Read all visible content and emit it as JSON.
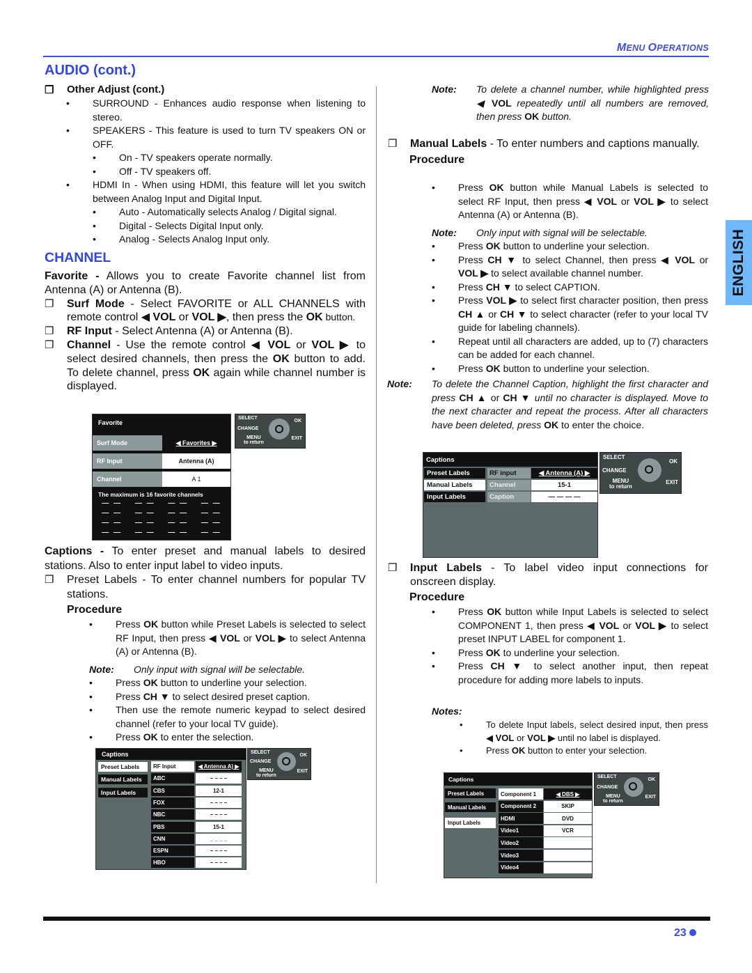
{
  "header": {
    "section_title_first": "M",
    "section_title_rest1": "ENU ",
    "section_title_second": "O",
    "section_title_rest2": "PERATIONS"
  },
  "language_tab": "ENGLISH",
  "page_number": "23",
  "left": {
    "audio_heading": "AUDIO (cont.)",
    "other_adjust": "Other Adjust (cont.)",
    "items": [
      "SURROUND - Enhances audio response when listening to stereo.",
      "SPEAKERS - This feature is used to turn TV speakers ON or OFF.",
      "HDMI In - When using HDMI, this feature will let you switch between Analog Input and Digital Input."
    ],
    "speakers_sub": [
      "On - TV speakers operate normally.",
      "Off - TV speakers off."
    ],
    "hdmi_sub": [
      "Auto - Automatically selects Analog / Digital signal.",
      "Digital - Selects Digital Input only.",
      "Analog - Selects Analog Input only."
    ],
    "channel_heading": "CHANNEL",
    "favorite_bold": "Favorite -",
    "favorite_text": " Allows you to create Favorite channel list from Antenna (A) or Antenna (B).",
    "surf_bold": "Surf Mode",
    "surf_text1": " - Select FAVORITE or ALL CHANNELS with remote control ◀ ",
    "surf_vol1": "VOL",
    "surf_or": " or ",
    "surf_vol2": "VOL ▶",
    "surf_text2": ", then press the ",
    "surf_ok": "OK",
    "surf_text3": " button.",
    "rf_bold": "RF Input",
    "rf_text": " - Select Antenna (A) or Antenna (B).",
    "channel_bold": "Channel",
    "channel_text1": " - Use the remote control ◀ ",
    "channel_vol1": "VOL",
    "channel_or": " or ",
    "channel_vol2": "VOL ▶",
    "channel_text2": " to select desired channels, then press the ",
    "channel_ok1": "OK",
    "channel_text3": " button to add. To delete channel, press ",
    "channel_ok2": "OK",
    "channel_text4": " again while channel number is displayed.",
    "captions_bold": "Captions -",
    "captions_text": " To enter preset and manual labels to desired stations. Also to enter input label to video inputs.",
    "preset_text": "Preset Labels - To enter channel numbers for popular TV stations.",
    "procedure": "Procedure",
    "preset_steps": {
      "s1a": "Press ",
      "s1b": "OK",
      "s1c": " button while Preset Labels is selected to select RF Input, then press ◀ ",
      "s1d": "VOL",
      "s1e": " or ",
      "s1f": "VOL ▶",
      "s1g": "    to select Antenna (A) or Antenna (B).",
      "note_label": "Note:",
      "note_text": "Only input with signal will be selectable.",
      "s2a": "Press ",
      "s2b": "OK",
      "s2c": " button to underline your selection.",
      "s3a": "Press ",
      "s3b": "CH ▼",
      "s3c": " to select desired preset caption.",
      "s4": "Then use the remote numeric keypad to select desired channel (refer to your local TV guide).",
      "s5a": "Press ",
      "s5b": "OK",
      "s5c": " to enter the selection."
    }
  },
  "right": {
    "note1_label": "Note:",
    "note1_a": "To delete a channel number, while highlighted press ◀ ",
    "note1_vol": "VOL",
    "note1_b": " repeatedly until all numbers are removed, then press ",
    "note1_ok": "OK",
    "note1_c": " button.",
    "manual_bold": "Manual Labels",
    "manual_text": " - To enter numbers and captions manually.",
    "procedure": "Procedure",
    "manual_steps": {
      "s1a": "Press ",
      "s1b": "OK",
      "s1c": " button while Manual Labels is selected to select RF Input, then press ◀ ",
      "s1d": "VOL",
      "s1e": " or ",
      "s1f": "VOL ▶",
      "s1g": "    to select Antenna (A) or Antenna (B).",
      "note_label": "Note:",
      "note_text": "Only input with signal will be selectable.",
      "s2a": "Press ",
      "s2b": "OK",
      "s2c": " button to underline your selection.",
      "s3a": "Press ",
      "s3b": "CH ▼",
      "s3c": " to select Channel, then press ◀ ",
      "s3d": "VOL",
      "s3e": " or ",
      "s3f": "VOL ▶",
      "s3g": "    to select available channel number.",
      "s4a": "Press ",
      "s4b": "CH ▼",
      "s4c": " to select CAPTION.",
      "s5a": "Press ",
      "s5b": "VOL ▶",
      "s5c": " to select first character position, then press ",
      "s5d": "CH ▲",
      "s5e": " or ",
      "s5f": "CH ▼",
      "s5g": "    to select character (refer to your local TV guide for labeling channels).",
      "s6": "Repeat until all characters are added, up to (7) characters can be added for each channel.",
      "s7a": "Press ",
      "s7b": "OK",
      "s7c": " button to underline your selection."
    },
    "note2_label": "Note:",
    "note2_a": "To delete the Channel Caption, highlight the first character and press ",
    "note2_ch1": "CH ▲",
    "note2_or": " or ",
    "note2_ch2": "CH ▼",
    "note2_b": " until no character is displayed. Move to the next character and repeat the process. After all characters have been deleted, press ",
    "note2_ok": "OK",
    "note2_c": " to enter the choice.",
    "input_bold": "Input Labels",
    "input_text": " - To label video input connections for onscreen display.",
    "input_steps": {
      "s1a": "Press ",
      "s1b": "OK",
      "s1c": " button while Input Labels is selected to select COMPONENT 1, then press ◀ ",
      "s1d": "VOL",
      "s1e": " or ",
      "s1f": "VOL ▶",
      "s1g": " to select preset INPUT LABEL for component 1.",
      "s2a": "Press ",
      "s2b": "OK",
      "s2c": " to underline your selection.",
      "s3a": "Press ",
      "s3b": "CH ▼",
      "s3c": " to select another input, then repeat procedure for adding more labels to inputs."
    },
    "notes_label": "Notes:",
    "notes": {
      "n1a": "To delete Input labels, select desired input, then press ◀ ",
      "n1b": "VOL",
      "n1c": " or ",
      "n1d": "VOL ▶",
      "n1e": " until no label is displayed.",
      "n2a": "Press ",
      "n2b": "OK",
      "n2c": " button to enter your selection."
    }
  },
  "remote_legend": {
    "select": "SELECT",
    "ok": "OK",
    "change": "CHANGE",
    "menu": "MENU",
    "to_return": "to return",
    "exit": "EXIT"
  },
  "osd_favorite": {
    "title": "Favorite",
    "rows": [
      {
        "label": "Surf Mode",
        "value": "◀ Favorites ▶"
      },
      {
        "label": "RF Input",
        "value": "Antenna (A)"
      },
      {
        "label": "Channel",
        "value": "A 1"
      }
    ],
    "footer": "The maximum is 16 favorite channels",
    "slots": [
      "— —",
      "— —",
      "— —",
      "— —",
      "— —",
      "— —",
      "— —",
      "— —",
      "— —",
      "— —",
      "— —",
      "— —",
      "— —",
      "— —",
      "— —",
      "— —"
    ]
  },
  "osd_preset": {
    "title": "Captions",
    "side": [
      "Preset Labels",
      "Manual Labels",
      "Input Labels"
    ],
    "rows": [
      {
        "label": "RF Input",
        "value": "◀ Antenna A) ▶"
      },
      {
        "label": "ABC",
        "value": "– – – –"
      },
      {
        "label": "CBS",
        "value": "12-1"
      },
      {
        "label": "FOX",
        "value": "– – – –"
      },
      {
        "label": "NBC",
        "value": "– – – –"
      },
      {
        "label": "PBS",
        "value": "15-1"
      },
      {
        "label": "CNN",
        "value": "_ _ _ _"
      },
      {
        "label": "ESPN",
        "value": "– – – –"
      },
      {
        "label": "HBO",
        "value": "– – – –"
      }
    ]
  },
  "osd_manual": {
    "title": "Captions",
    "side": [
      "Preset Labels",
      "Manual Labels",
      "Input Labels"
    ],
    "rows": [
      {
        "label": "RF input",
        "value": "◀ Antenna (A) ▶"
      },
      {
        "label": "Channel",
        "value": "15-1"
      },
      {
        "label": "Caption",
        "value": "— — — —"
      }
    ]
  },
  "osd_input": {
    "title": "Captions",
    "side": [
      "Preset Labels",
      "Manual Labels",
      "Input Labels"
    ],
    "rows": [
      {
        "label": "Component 1",
        "value": "◀   DBS   ▶"
      },
      {
        "label": "Component 2",
        "value": "SKIP"
      },
      {
        "label": "HDMI",
        "value": "DVD"
      },
      {
        "label": "Video1",
        "value": "VCR"
      },
      {
        "label": "Video2",
        "value": ""
      },
      {
        "label": "Video3",
        "value": ""
      },
      {
        "label": "Video4",
        "value": ""
      }
    ]
  }
}
